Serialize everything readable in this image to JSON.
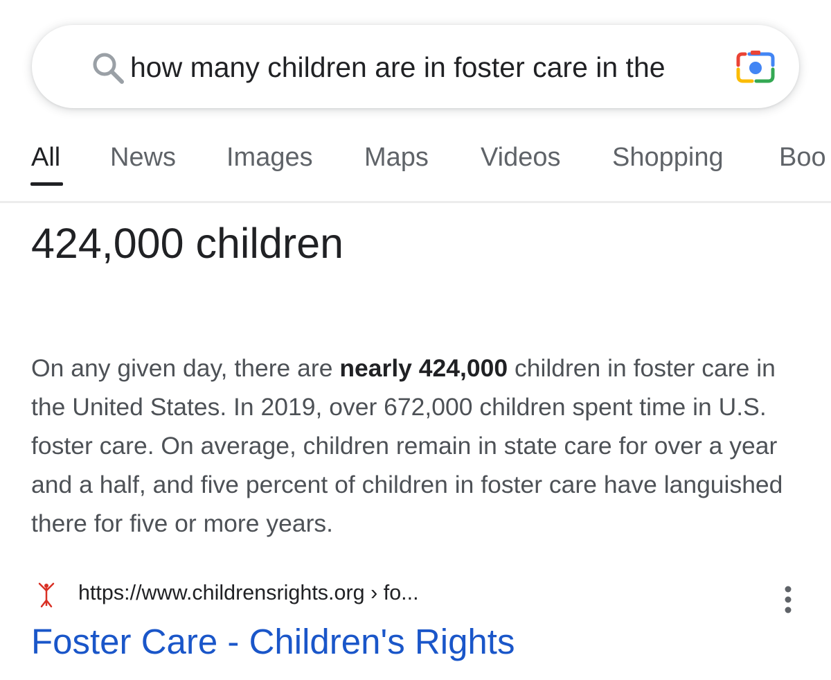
{
  "search": {
    "query": "how many children are in foster care in the",
    "icon": "search-icon",
    "camera_icon": "google-lens-camera-icon"
  },
  "tabs": [
    {
      "label": "All",
      "active": true
    },
    {
      "label": "News",
      "active": false
    },
    {
      "label": "Images",
      "active": false
    },
    {
      "label": "Maps",
      "active": false
    },
    {
      "label": "Videos",
      "active": false
    },
    {
      "label": "Shopping",
      "active": false
    },
    {
      "label": "Boo",
      "active": false
    }
  ],
  "answer": {
    "headline": "424,000 children",
    "snippet_before": "On any given day, there are ",
    "snippet_bold": "nearly 424,000",
    "snippet_after": " children in foster care in the United States. In 2019, over 672,000 children spent time in U.S. foster care. On average, children remain in state care for over a year and a half, and five percent of children in foster care have languished there for five or more years."
  },
  "result": {
    "favicon": "childrens-rights-favicon",
    "url": "https://www.childrensrights.org › fo...",
    "title": "Foster Care - Children's Rights",
    "more_icon": "more-vert-icon"
  },
  "colors": {
    "title_link": "#1a56c9",
    "body_text": "#4d5156",
    "headline_text": "#202124",
    "tab_inactive": "#5f6368"
  }
}
